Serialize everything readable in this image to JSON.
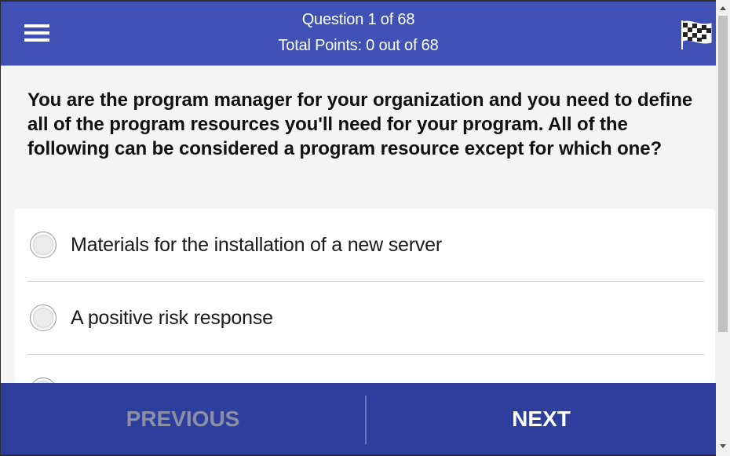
{
  "header": {
    "question_counter": "Question 1 of 68",
    "total_points": "Total Points: 0 out of 68",
    "menu_icon": "hamburger-menu-icon",
    "finish_icon": "checkered-flag-icon",
    "color": "#3f51b5"
  },
  "question": {
    "text": "You are the program manager for your organization and you need to define all of the program resources you'll need for your program. All of the following can be considered a program resource except for which one?"
  },
  "options": [
    {
      "label": "Materials for the installation of a new server"
    },
    {
      "label": "A positive risk response"
    },
    {
      "label": ""
    }
  ],
  "footer": {
    "previous_label": "PREVIOUS",
    "next_label": "NEXT",
    "color": "#2e3e9d"
  }
}
